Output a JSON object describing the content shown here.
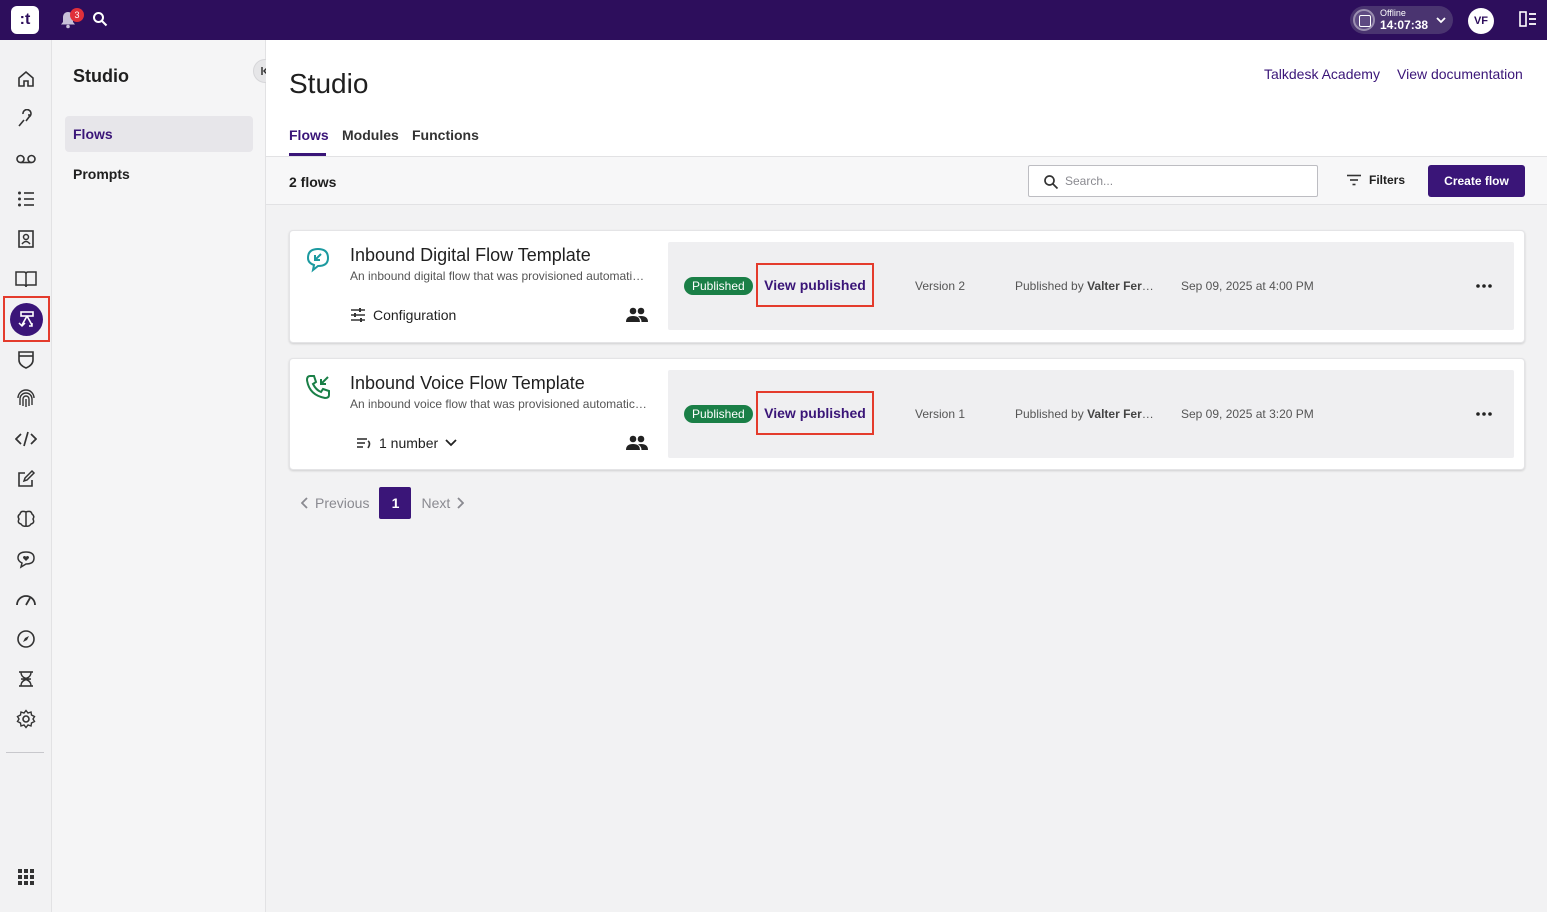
{
  "topbar": {
    "logo_text": ":t",
    "notification_count": "3",
    "status_label": "Offline",
    "status_time": "14:07:38",
    "avatar_initials": "VF"
  },
  "rail": {
    "items": [
      "home-icon",
      "handshake-icon",
      "voicemail-icon",
      "list-icon",
      "contacts-icon",
      "book-icon",
      "studio-flows-icon",
      "shield-icon",
      "fingerprint-icon",
      "code-icon",
      "edit-icon",
      "brain-icon",
      "chat-heart-icon",
      "gauge-icon",
      "compass-icon",
      "dna-icon",
      "settings-icon"
    ],
    "active": "studio-flows-icon",
    "bottom": "apps-grid-icon"
  },
  "sidebar": {
    "title": "Studio",
    "items": [
      {
        "label": "Flows",
        "active": true
      },
      {
        "label": "Prompts",
        "active": false
      }
    ]
  },
  "header": {
    "title": "Studio",
    "links": [
      "Talkdesk Academy",
      "View documentation"
    ],
    "tabs": [
      {
        "label": "Flows",
        "active": true
      },
      {
        "label": "Modules",
        "active": false
      },
      {
        "label": "Functions",
        "active": false
      }
    ]
  },
  "toolbar": {
    "count_label": "2 flows",
    "search_placeholder": "Search...",
    "filters_label": "Filters",
    "create_label": "Create flow"
  },
  "flows": [
    {
      "title": "Inbound Digital Flow Template",
      "description": "An inbound digital flow that was provisioned automatically",
      "meta_label": "Configuration",
      "meta_icon": "sliders-icon",
      "type_icon": "digital-chat-icon",
      "status": "Published",
      "action": "View published",
      "version": "Version 2",
      "published_by_prefix": "Published by",
      "published_by_name": "Valter Fernandes",
      "published_at": "Sep 09, 2025 at 4:00 PM"
    },
    {
      "title": "Inbound Voice Flow Template",
      "description": "An inbound voice flow that was provisioned automatically",
      "meta_label": "1 number",
      "meta_icon": "phone-list-icon",
      "type_icon": "voice-phone-icon",
      "status": "Published",
      "action": "View published",
      "version": "Version 1",
      "published_by_prefix": "Published by",
      "published_by_name": "Valter Fernandes",
      "published_at": "Sep 09, 2025 at 3:20 PM"
    }
  ],
  "pagination": {
    "previous_label": "Previous",
    "current_page": "1",
    "next_label": "Next"
  },
  "colors": {
    "brand": "#2d0e5c",
    "accent": "#3a1578",
    "published": "#1a7f47",
    "highlight": "#e43b2c"
  }
}
